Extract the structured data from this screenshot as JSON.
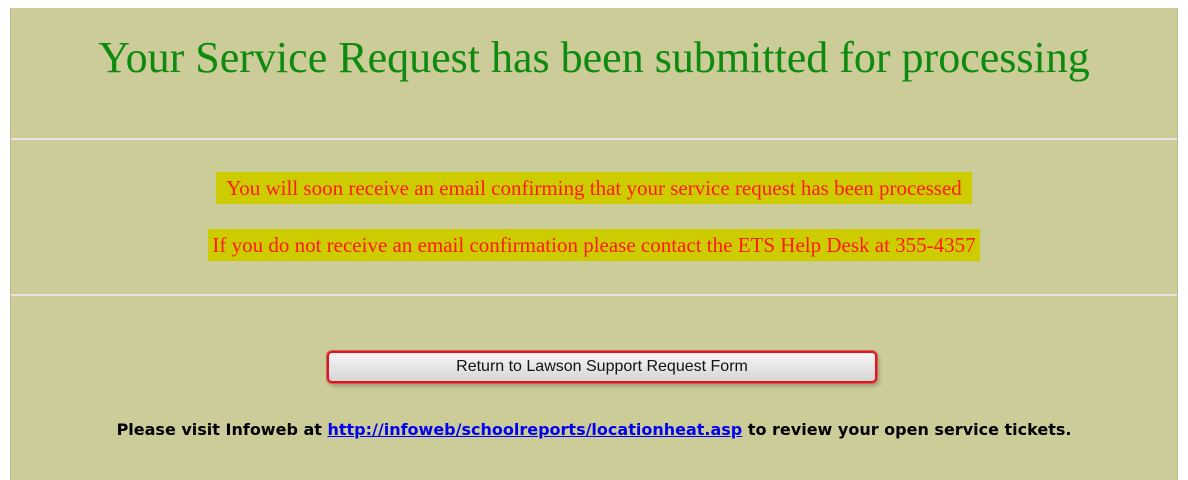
{
  "header": {
    "title": "Your Service Request has been submitted for processing"
  },
  "messages": {
    "confirmation": "You will soon receive an email confirming that your service request has been processed",
    "contact": "If you do not receive an email confirmation please contact the ETS Help Desk at 355-4357"
  },
  "actions": {
    "return_label": "Return to Lawson Support Request Form"
  },
  "footer": {
    "visit_prefix": "Please visit Infoweb at ",
    "link_text": "http://infoweb/schoolreports/locationheat.asp",
    "visit_suffix": " to review your open service tickets."
  },
  "colors": {
    "background": "#cccc99",
    "title": "#0e8a0e",
    "highlight": "#cccc00",
    "warning_text": "#ff1a1a",
    "button_border": "#e8141c",
    "link": "#0000ee"
  }
}
